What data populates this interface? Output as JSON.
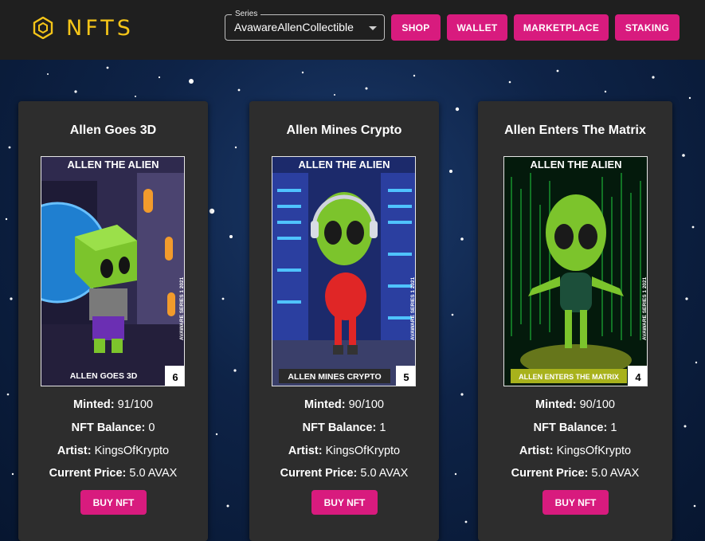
{
  "header": {
    "logo_text": "NFTS",
    "series": {
      "legend": "Series",
      "value": "AvawareAllenCollectible"
    },
    "nav": [
      "SHOP",
      "WALLET",
      "MARKETPLACE",
      "STAKING"
    ]
  },
  "cards": [
    {
      "title": "Allen Goes 3D",
      "art_header": "ALLEN THE ALIEN",
      "art_caption": "ALLEN GOES 3D",
      "art_number": "6",
      "art_side": "AVAWARE SERIES 1 2021",
      "minted_label": "Minted:",
      "minted": "91/100",
      "balance_label": "NFT Balance:",
      "balance": "0",
      "artist_label": "Artist:",
      "artist": "KingsOfKrypto",
      "price_label": "Current Price:",
      "price": "5.0 AVAX",
      "buy": "BUY NFT"
    },
    {
      "title": "Allen Mines Crypto",
      "art_header": "ALLEN THE ALIEN",
      "art_caption": "ALLEN MINES CRYPTO",
      "art_number": "5",
      "art_side": "AVAWARE SERIES 1 2021",
      "minted_label": "Minted:",
      "minted": "90/100",
      "balance_label": "NFT Balance:",
      "balance": "1",
      "artist_label": "Artist:",
      "artist": "KingsOfKrypto",
      "price_label": "Current Price:",
      "price": "5.0 AVAX",
      "buy": "BUY NFT"
    },
    {
      "title": "Allen Enters The Matrix",
      "art_header": "ALLEN THE ALIEN",
      "art_caption": "ALLEN ENTERS THE MATRIX",
      "art_number": "4",
      "art_side": "AVAWARE SERIES 1 2021",
      "minted_label": "Minted:",
      "minted": "90/100",
      "balance_label": "NFT Balance:",
      "balance": "1",
      "artist_label": "Artist:",
      "artist": "KingsOfKrypto",
      "price_label": "Current Price:",
      "price": "5.0 AVAX",
      "buy": "BUY NFT"
    }
  ],
  "colors": {
    "accent": "#d81b7e",
    "logo": "#f5c518",
    "card": "#2d2d2d",
    "topbar": "#1f1f1f"
  }
}
